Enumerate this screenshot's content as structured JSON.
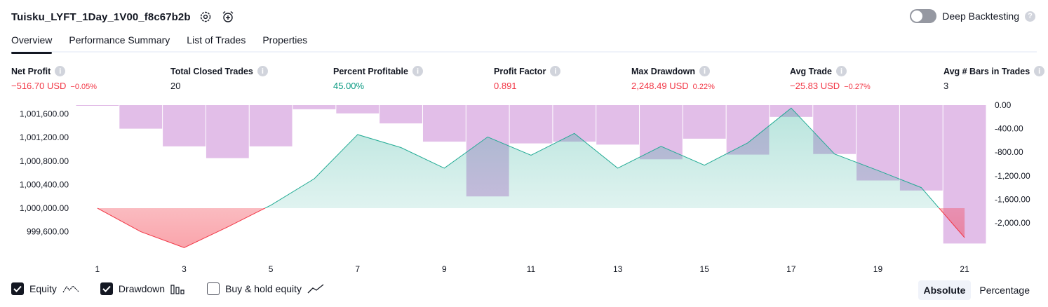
{
  "header": {
    "title": "Tuisku_LYFT_1Day_1V00_f8c67b2b",
    "deep_backtesting_label": "Deep Backtesting"
  },
  "tabs": [
    {
      "label": "Overview"
    },
    {
      "label": "Performance Summary"
    },
    {
      "label": "List of Trades"
    },
    {
      "label": "Properties"
    }
  ],
  "stats": [
    {
      "label": "Net Profit",
      "value": "−516.70 USD",
      "pct": "−0.05%",
      "tone": "neg"
    },
    {
      "label": "Total Closed Trades",
      "value": "20",
      "pct": "",
      "tone": "neu"
    },
    {
      "label": "Percent Profitable",
      "value": "45.00%",
      "pct": "",
      "tone": "pos"
    },
    {
      "label": "Profit Factor",
      "value": "0.891",
      "pct": "",
      "tone": "neg"
    },
    {
      "label": "Max Drawdown",
      "value": "2,248.49 USD",
      "pct": "0.22%",
      "tone": "neg"
    },
    {
      "label": "Avg Trade",
      "value": "−25.83 USD",
      "pct": "−0.27%",
      "tone": "neg"
    },
    {
      "label": "Avg # Bars in Trades",
      "value": "3",
      "pct": "",
      "tone": "neu"
    }
  ],
  "chart_data": {
    "type": "line",
    "x": [
      1,
      2,
      3,
      4,
      5,
      6,
      7,
      8,
      9,
      10,
      11,
      12,
      13,
      14,
      15,
      16,
      17,
      18,
      19,
      20,
      21
    ],
    "x_tick_labels": [
      "1",
      "3",
      "5",
      "7",
      "9",
      "11",
      "13",
      "15",
      "17",
      "19",
      "21"
    ],
    "left_axis_ticks": [
      "1,001,600.00",
      "1,001,200.00",
      "1,000,800.00",
      "1,000,400.00",
      "1,000,000.00",
      "999,600.00"
    ],
    "right_axis_ticks": [
      "0.00",
      "-400.00",
      "-800.00",
      "-1,200.00",
      "-1,600.00",
      "-2,000.00"
    ],
    "baseline": 1000000,
    "ylim_left": [
      999250,
      1001750
    ],
    "ylim_right": [
      -2300,
      200
    ],
    "series": [
      {
        "name": "Equity",
        "values": [
          1000000,
          999600,
          999330,
          999680,
          1000050,
          1000500,
          1001250,
          1001030,
          1000680,
          1001210,
          1000900,
          1001270,
          1000680,
          1001050,
          1000730,
          1001110,
          1001700,
          1000920,
          1000640,
          1000350,
          999500
        ]
      },
      {
        "name": "Drawdown",
        "values": [
          -10,
          -400,
          -700,
          -900,
          -700,
          -70,
          -140,
          -310,
          -620,
          -1550,
          -650,
          -620,
          -670,
          -920,
          -570,
          -840,
          -200,
          -830,
          -1280,
          -1450,
          -2350
        ]
      }
    ],
    "colors": {
      "equity_up": "#22ab94",
      "equity_down": "#f23645",
      "drawdown": "#ce93d8"
    }
  },
  "legend": [
    {
      "label": "Equity",
      "checked": true
    },
    {
      "label": "Drawdown",
      "checked": true
    },
    {
      "label": "Buy & hold equity",
      "checked": false
    }
  ],
  "modes": [
    {
      "label": "Absolute",
      "active": true
    },
    {
      "label": "Percentage",
      "active": false
    }
  ]
}
